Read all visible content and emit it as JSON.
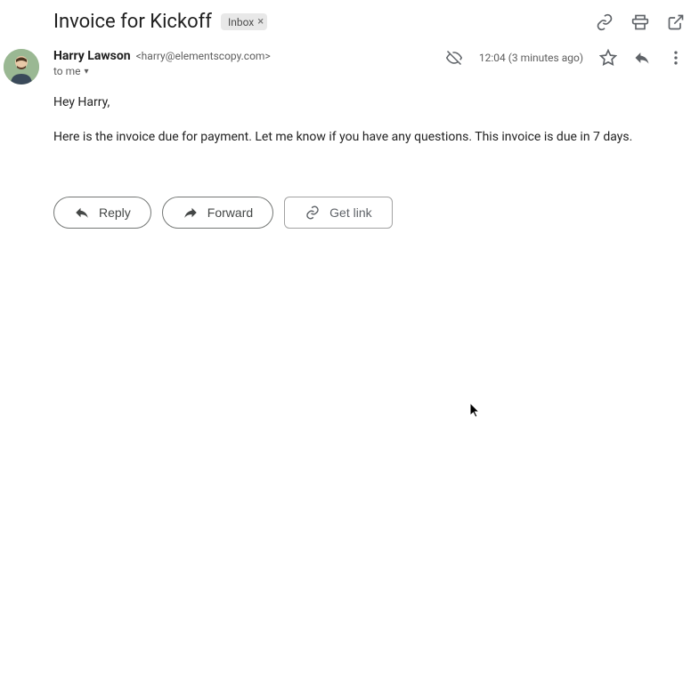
{
  "subject": "Invoice for Kickoff",
  "label": "Inbox",
  "sender": {
    "name": "Harry Lawson",
    "email": "<harry@elementscopy.com>"
  },
  "recipient": "to me",
  "timestamp": "12:04 (3 minutes ago)",
  "body": {
    "greeting": "Hey Harry,",
    "paragraph": "Here is the invoice due for payment. Let me know if you have any questions. This invoice is due in 7 days."
  },
  "actions": {
    "reply": "Reply",
    "forward": "Forward",
    "getlink": "Get link"
  }
}
